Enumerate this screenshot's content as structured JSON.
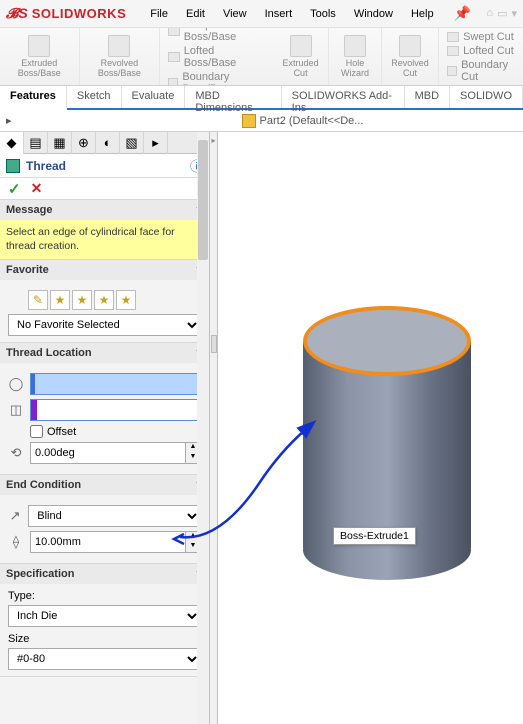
{
  "app": {
    "name": "SOLIDWORKS"
  },
  "menu": [
    "File",
    "Edit",
    "View",
    "Insert",
    "Tools",
    "Window",
    "Help"
  ],
  "ribbon": {
    "extruded": "Extruded\nBoss/Base",
    "revolved": "Revolved\nBoss/Base",
    "swept": "Swept Boss/Base",
    "lofted": "Lofted Boss/Base",
    "boundary": "Boundary Boss/Base",
    "extcut": "Extruded\nCut",
    "hole": "Hole Wizard",
    "revcut": "Revolved\nCut",
    "sweptcut": "Swept Cut",
    "loftcut": "Lofted Cut",
    "boundcut": "Boundary Cut"
  },
  "tabs": [
    "Features",
    "Sketch",
    "Evaluate",
    "MBD Dimensions",
    "SOLIDWORKS Add-Ins",
    "MBD",
    "SOLIDWO"
  ],
  "crumb": {
    "part": "Part2  (Default<<De..."
  },
  "feature": {
    "title": "Thread",
    "message_head": "Message",
    "message": "Select an edge of cylindrical face for thread creation.",
    "favorite_head": "Favorite",
    "favorite_sel": "No Favorite Selected",
    "location_head": "Thread Location",
    "offset": "Offset",
    "angle": "0.00deg",
    "endcond_head": "End Condition",
    "endcond_type": "Blind",
    "depth": "10.00mm",
    "spec_head": "Specification",
    "type_lbl": "Type:",
    "type_val": "Inch Die",
    "size_lbl": "Size",
    "size_val": "#0-80"
  },
  "tooltip": "Boss-Extrude1"
}
